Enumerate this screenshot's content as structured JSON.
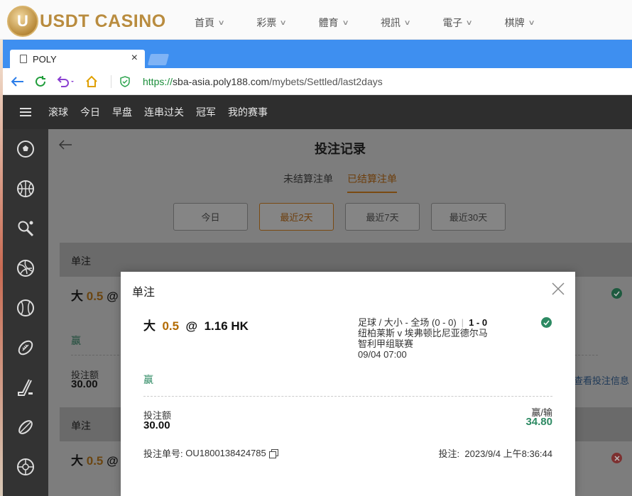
{
  "site": {
    "logo_text": "USDT CASINO",
    "nav": [
      "首頁",
      "彩票",
      "體育",
      "視訊",
      "電子",
      "棋牌"
    ]
  },
  "browser": {
    "tab_title": "POLY",
    "url_scheme": "https://",
    "url_host": "sba-asia.poly188.com",
    "url_path": "/mybets/Settled/last2days"
  },
  "app": {
    "topnav": [
      "滚球",
      "今日",
      "早盘",
      "连串过关",
      "冠军",
      "我的赛事"
    ],
    "sidebar_icons": [
      "soccer-icon",
      "basketball-icon",
      "tennis-icon",
      "volleyball-icon",
      "baseball-icon",
      "american-football-icon",
      "hockey-icon",
      "rugby-icon",
      "futsal-icon"
    ],
    "page_title": "投注记录",
    "subtabs": [
      "未结算注单",
      "已结算注单"
    ],
    "active_subtab": "已结算注单",
    "filters": [
      "今日",
      "最近2天",
      "最近7天",
      "最近30天"
    ],
    "active_filter": "最近2天",
    "list": [
      {
        "header": "单注",
        "selection": "大",
        "line": "0.5",
        "at": "@",
        "status": "赢",
        "stake_label": "投注额",
        "stake": "30.00",
        "link": "查看投注信息",
        "result": "win"
      },
      {
        "header": "单注",
        "selection": "大",
        "line": "0.5",
        "at": "@",
        "result": "lose"
      }
    ]
  },
  "modal": {
    "title": "单注",
    "selection": "大",
    "line": "0.5",
    "at": "@",
    "odds": "1.16 HK",
    "market": "足球 / 大小 - 全场 (0 - 0)",
    "score": "1 - 0",
    "teams": "纽柏莱斯 v 埃弗顿比尼亚德尔马",
    "league": "智利甲组联赛",
    "kickoff": "09/04 07:00",
    "status": "赢",
    "stake_label": "投注额",
    "stake": "30.00",
    "winloss_label": "赢/输",
    "winloss": "34.80",
    "ticket_label": "投注单号:",
    "ticket_no": "OU1800138424785",
    "bet_time_label": "投注:",
    "bet_time": "2023/9/4 上午8:36:44"
  },
  "colors": {
    "accent_brown": "#b26a00",
    "win_green": "#2d8a63",
    "lose_red": "#c94a4a",
    "browser_blue": "#3e8ff0"
  }
}
